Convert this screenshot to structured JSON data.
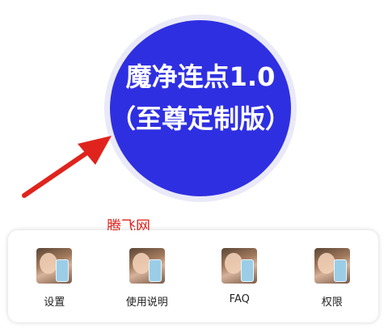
{
  "hero": {
    "title": "魔净连点1.0（至尊定制版）"
  },
  "watermark": {
    "text": "腾飞网"
  },
  "colors": {
    "circle": "#2f2fe2",
    "circle_halo": "#e9e9f8",
    "arrow": "#e0241d",
    "watermark": "#e0241d"
  },
  "menu": {
    "items": [
      {
        "label": "设置",
        "icon": "avatar-photo-icon"
      },
      {
        "label": "使用说明",
        "icon": "avatar-photo-icon"
      },
      {
        "label": "FAQ",
        "icon": "avatar-photo-icon"
      },
      {
        "label": "权限",
        "icon": "avatar-photo-icon"
      }
    ]
  }
}
